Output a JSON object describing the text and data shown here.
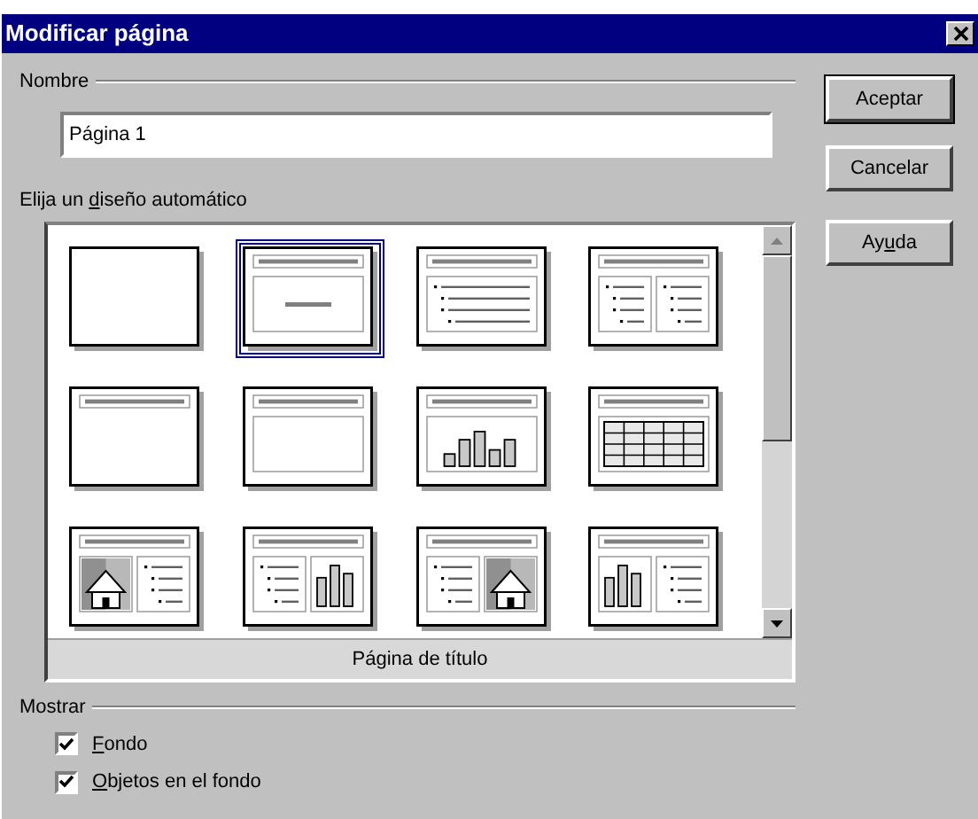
{
  "window": {
    "title": "Modificar página"
  },
  "name_group": {
    "legend": "Nombre",
    "value": "Página 1"
  },
  "layout_group": {
    "label_parts": {
      "pre": "Elija un ",
      "key": "d",
      "post": "iseño automático"
    },
    "layouts": [
      {
        "kind": "blank",
        "selected": false
      },
      {
        "kind": "title",
        "selected": true
      },
      {
        "kind": "bullets",
        "selected": false
      },
      {
        "kind": "two_bullets",
        "selected": false
      },
      {
        "kind": "title_only",
        "selected": false
      },
      {
        "kind": "content",
        "selected": false
      },
      {
        "kind": "chart",
        "selected": false
      },
      {
        "kind": "table",
        "selected": false
      },
      {
        "kind": "picture_bullets",
        "selected": false
      },
      {
        "kind": "bullets_chart",
        "selected": false
      },
      {
        "kind": "bullets_picture",
        "selected": false
      },
      {
        "kind": "chart_bullets",
        "selected": false
      }
    ],
    "caption": "Página de título"
  },
  "show_group": {
    "legend": "Mostrar",
    "options": [
      {
        "label_parts": {
          "key": "F",
          "post": "ondo"
        },
        "checked": true
      },
      {
        "label_parts": {
          "key": "O",
          "post": "bjetos en el fondo"
        },
        "checked": true
      }
    ]
  },
  "buttons": [
    {
      "label_parts": {
        "pre": "Aceptar"
      },
      "default": true
    },
    {
      "label_parts": {
        "pre": "Cancelar"
      },
      "default": false
    },
    {
      "label_parts": {
        "pre": "Ay",
        "key": "u",
        "post": "da"
      },
      "default": false
    }
  ]
}
